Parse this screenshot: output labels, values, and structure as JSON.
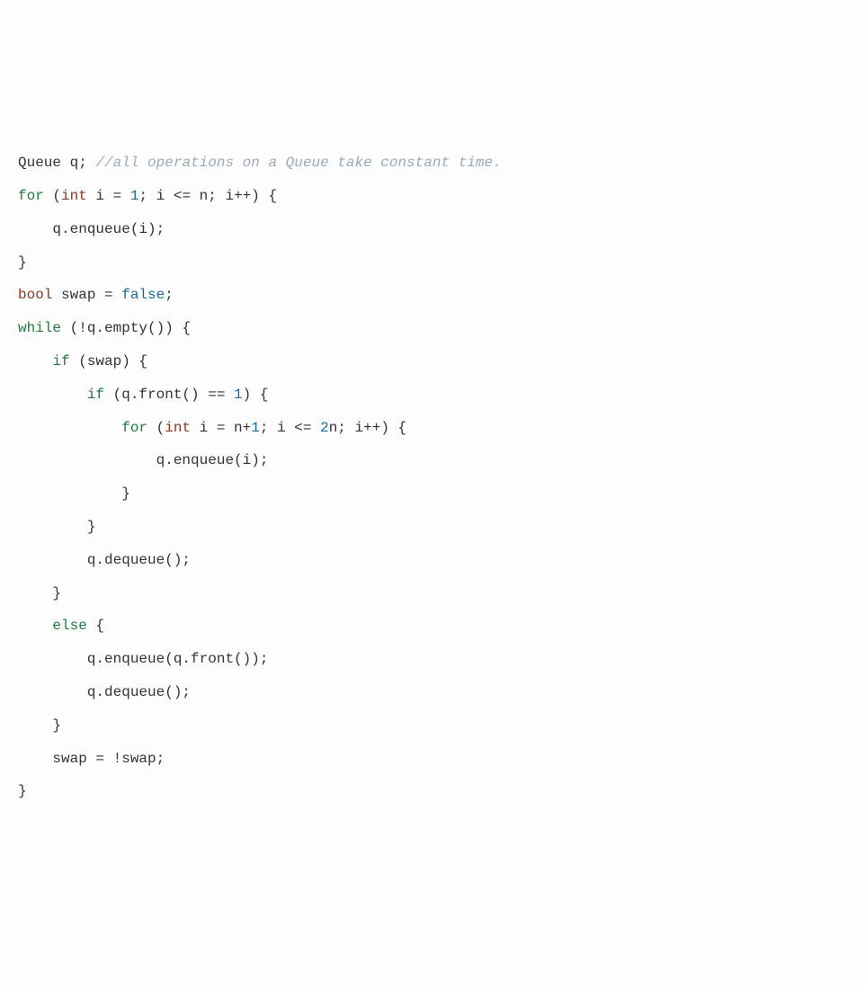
{
  "code": {
    "lines": [
      {
        "indent": 0,
        "tokens": [
          {
            "cls": "c-ident",
            "text": "Queue q; "
          },
          {
            "cls": "c-comment",
            "text": "//all operations on a Queue take constant time."
          }
        ]
      },
      {
        "indent": 0,
        "tokens": [
          {
            "cls": "c-keyword",
            "text": "for"
          },
          {
            "cls": "c-punct",
            "text": " ("
          },
          {
            "cls": "c-type",
            "text": "int"
          },
          {
            "cls": "c-ident",
            "text": " i = "
          },
          {
            "cls": "c-num",
            "text": "1"
          },
          {
            "cls": "c-punct",
            "text": "; i <= n; i++) {"
          }
        ]
      },
      {
        "indent": 1,
        "tokens": [
          {
            "cls": "c-ident",
            "text": "q.enqueue(i);"
          }
        ]
      },
      {
        "indent": 0,
        "tokens": [
          {
            "cls": "c-punct",
            "text": "}"
          }
        ]
      },
      {
        "indent": 0,
        "tokens": [
          {
            "cls": "c-type",
            "text": "bool"
          },
          {
            "cls": "c-ident",
            "text": " swap = "
          },
          {
            "cls": "c-bool",
            "text": "false"
          },
          {
            "cls": "c-punct",
            "text": ";"
          }
        ]
      },
      {
        "indent": 0,
        "tokens": [
          {
            "cls": "c-keyword",
            "text": "while"
          },
          {
            "cls": "c-punct",
            "text": " (!q.empty()) {"
          }
        ]
      },
      {
        "indent": 1,
        "tokens": [
          {
            "cls": "c-keyword",
            "text": "if"
          },
          {
            "cls": "c-punct",
            "text": " (swap) {"
          }
        ]
      },
      {
        "indent": 2,
        "tokens": [
          {
            "cls": "c-keyword",
            "text": "if"
          },
          {
            "cls": "c-punct",
            "text": " (q.front() == "
          },
          {
            "cls": "c-num",
            "text": "1"
          },
          {
            "cls": "c-punct",
            "text": ") {"
          }
        ]
      },
      {
        "indent": 3,
        "tokens": [
          {
            "cls": "c-keyword",
            "text": "for"
          },
          {
            "cls": "c-punct",
            "text": " ("
          },
          {
            "cls": "c-type",
            "text": "int"
          },
          {
            "cls": "c-ident",
            "text": " i = n+"
          },
          {
            "cls": "c-num",
            "text": "1"
          },
          {
            "cls": "c-punct",
            "text": "; i <= "
          },
          {
            "cls": "c-num",
            "text": "2"
          },
          {
            "cls": "c-ident",
            "text": "n; i++) {"
          }
        ]
      },
      {
        "indent": 4,
        "tokens": [
          {
            "cls": "c-ident",
            "text": "q.enqueue(i);"
          }
        ]
      },
      {
        "indent": 3,
        "tokens": [
          {
            "cls": "c-punct",
            "text": "}"
          }
        ]
      },
      {
        "indent": 2,
        "tokens": [
          {
            "cls": "c-punct",
            "text": "}"
          }
        ]
      },
      {
        "indent": 2,
        "tokens": [
          {
            "cls": "c-ident",
            "text": "q.dequeue();"
          }
        ]
      },
      {
        "indent": 1,
        "tokens": [
          {
            "cls": "c-punct",
            "text": "}"
          }
        ]
      },
      {
        "indent": 1,
        "tokens": [
          {
            "cls": "c-keyword",
            "text": "else"
          },
          {
            "cls": "c-punct",
            "text": " {"
          }
        ]
      },
      {
        "indent": 2,
        "tokens": [
          {
            "cls": "c-ident",
            "text": "q.enqueue(q.front());"
          }
        ]
      },
      {
        "indent": 2,
        "tokens": [
          {
            "cls": "c-ident",
            "text": "q.dequeue();"
          }
        ]
      },
      {
        "indent": 1,
        "tokens": [
          {
            "cls": "c-punct",
            "text": "}"
          }
        ]
      },
      {
        "indent": 1,
        "tokens": [
          {
            "cls": "c-ident",
            "text": "swap = !swap;"
          }
        ]
      },
      {
        "indent": 0,
        "tokens": [
          {
            "cls": "c-punct",
            "text": "}"
          }
        ]
      }
    ],
    "indent_unit": "    "
  }
}
